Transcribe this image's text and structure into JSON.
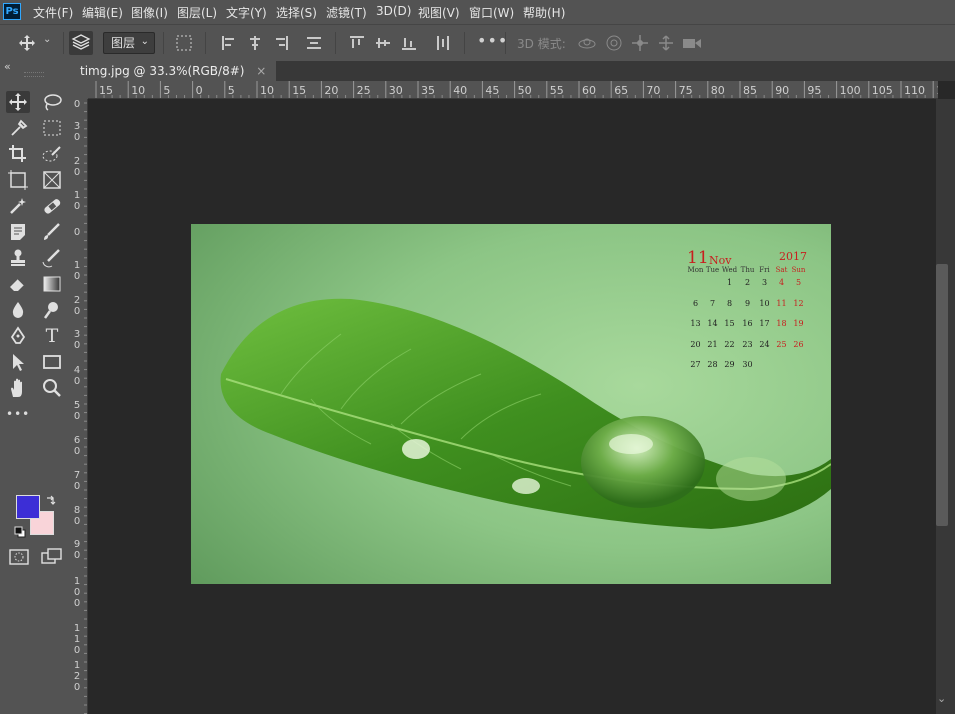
{
  "app": {
    "logo_text": "Ps",
    "menu": [
      "文件(F)",
      "编辑(E)",
      "图像(I)",
      "图层(L)",
      "文字(Y)",
      "选择(S)",
      "滤镜(T)",
      "3D(D)",
      "视图(V)",
      "窗口(W)",
      "帮助(H)"
    ]
  },
  "options_bar": {
    "auto_select_target": "图层",
    "three_d_mode_label": "3D 模式:"
  },
  "toolbar": {
    "collapse_icon": "«",
    "foreground_color": "#3c2ed6",
    "background_color": "#f9d4d9"
  },
  "document": {
    "tab_title": "timg.jpg @ 33.3%(RGB/8#)",
    "close_glyph": "×"
  },
  "rulers": {
    "horizontal_labels": [
      "15",
      "10",
      "5",
      "0",
      "5",
      "10",
      "15",
      "20",
      "25",
      "30",
      "35",
      "40",
      "45",
      "50",
      "55",
      "60",
      "65",
      "70",
      "75",
      "80",
      "85",
      "90",
      "95",
      "100",
      "105",
      "110",
      "1"
    ],
    "vertical_labels": [
      "0",
      "3\n0",
      "2\n0",
      "1\n0",
      "0",
      "1\n0",
      "2\n0",
      "3\n0",
      "4\n0",
      "5\n0",
      "6\n0",
      "7\n0",
      "8\n0",
      "9\n0",
      "1\n0\n0",
      "1\n1\n0",
      "1\n2\n0"
    ]
  },
  "image_calendar": {
    "day": "11",
    "month": "Nov",
    "year": "2017",
    "weekdays": [
      "Mon",
      "Tue",
      "Wed",
      "Thu",
      "Fri",
      "Sat",
      "Sun"
    ],
    "weeks": [
      [
        "",
        "",
        "1",
        "2",
        "3",
        "4",
        "5"
      ],
      [
        "6",
        "7",
        "8",
        "9",
        "10",
        "11",
        "12"
      ],
      [
        "13",
        "14",
        "15",
        "16",
        "17",
        "18",
        "19"
      ],
      [
        "20",
        "21",
        "22",
        "23",
        "24",
        "25",
        "26"
      ],
      [
        "27",
        "28",
        "29",
        "30",
        "",
        "",
        ""
      ]
    ]
  }
}
